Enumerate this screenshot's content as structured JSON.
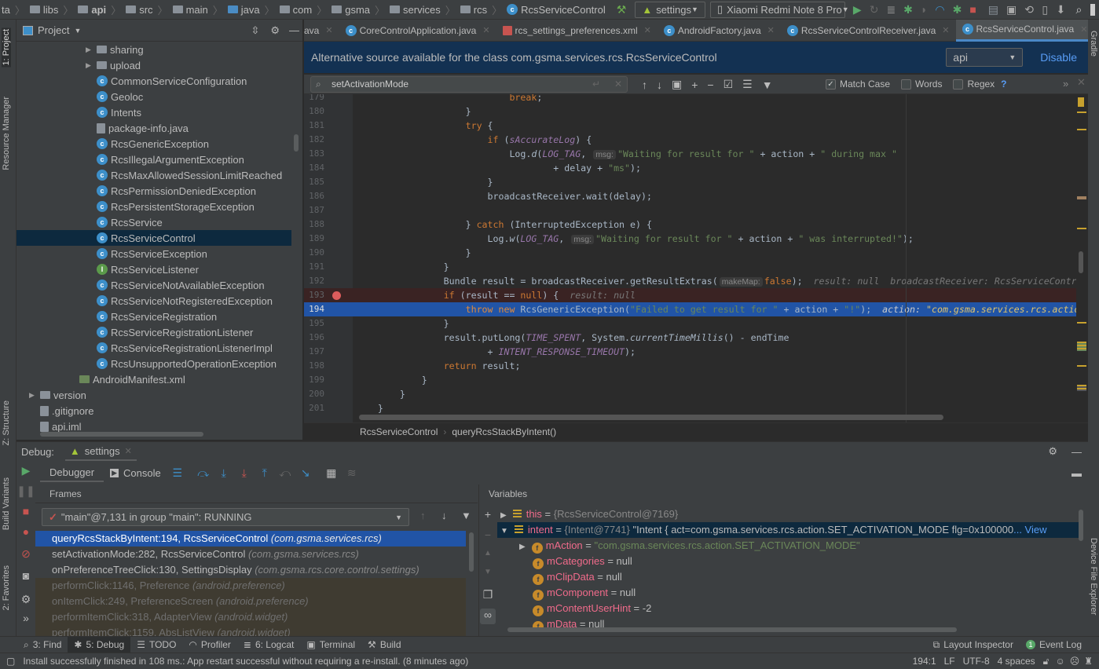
{
  "navbar": {
    "crumbs": [
      {
        "label": "ta",
        "icon": "none"
      },
      {
        "label": "libs",
        "icon": "folder"
      },
      {
        "label": "api",
        "icon": "module-folder"
      },
      {
        "label": "src",
        "icon": "folder"
      },
      {
        "label": "main",
        "icon": "folder"
      },
      {
        "label": "java",
        "icon": "source-folder"
      },
      {
        "label": "com",
        "icon": "package"
      },
      {
        "label": "gsma",
        "icon": "package"
      },
      {
        "label": "services",
        "icon": "package"
      },
      {
        "label": "rcs",
        "icon": "package"
      },
      {
        "label": "RcsServiceControl",
        "icon": "class"
      }
    ],
    "run_config": "settings",
    "device": "Xiaomi Redmi Note 8 Pro"
  },
  "left_stripe": {
    "project": "1: Project",
    "resource_manager": "Resource Manager",
    "structure": "Z: Structure",
    "build_variants": "Build Variants",
    "favorites": "2: Favorites"
  },
  "right_stripe": {
    "gradle": "Gradle",
    "device_explorer": "Device File Explorer"
  },
  "project": {
    "title": "Project",
    "items": [
      {
        "label": "sharing",
        "type": "folder",
        "expandable": true
      },
      {
        "label": "upload",
        "type": "folder",
        "expandable": true
      },
      {
        "label": "CommonServiceConfiguration",
        "type": "class"
      },
      {
        "label": "Geoloc",
        "type": "class"
      },
      {
        "label": "Intents",
        "type": "class"
      },
      {
        "label": "package-info.java",
        "type": "file"
      },
      {
        "label": "RcsGenericException",
        "type": "class"
      },
      {
        "label": "RcsIllegalArgumentException",
        "type": "class"
      },
      {
        "label": "RcsMaxAllowedSessionLimitReached",
        "type": "class"
      },
      {
        "label": "RcsPermissionDeniedException",
        "type": "class"
      },
      {
        "label": "RcsPersistentStorageException",
        "type": "class"
      },
      {
        "label": "RcsService",
        "type": "class"
      },
      {
        "label": "RcsServiceControl",
        "type": "class",
        "selected": true
      },
      {
        "label": "RcsServiceException",
        "type": "class"
      },
      {
        "label": "RcsServiceListener",
        "type": "interface"
      },
      {
        "label": "RcsServiceNotAvailableException",
        "type": "class"
      },
      {
        "label": "RcsServiceNotRegisteredException",
        "type": "class"
      },
      {
        "label": "RcsServiceRegistration",
        "type": "class"
      },
      {
        "label": "RcsServiceRegistrationListener",
        "type": "class"
      },
      {
        "label": "RcsServiceRegistrationListenerImpl",
        "type": "class"
      },
      {
        "label": "RcsUnsupportedOperationException",
        "type": "class"
      },
      {
        "label": "AndroidManifest.xml",
        "type": "manifest",
        "level": "up"
      },
      {
        "label": "version",
        "type": "folder",
        "expandable": true,
        "level": "top"
      },
      {
        "label": ".gitignore",
        "type": "file",
        "level": "top"
      },
      {
        "label": "api.iml",
        "type": "file",
        "level": "top"
      }
    ]
  },
  "tabs": [
    {
      "label": "ava"
    },
    {
      "label": "CoreControlApplication.java"
    },
    {
      "label": "rcs_settings_preferences.xml"
    },
    {
      "label": "AndroidFactory.java"
    },
    {
      "label": "RcsServiceControlReceiver.java"
    },
    {
      "label": "RcsServiceControl.java",
      "active": true
    }
  ],
  "tabs_overflow": "5",
  "banner": {
    "text": "Alternative source available for the class com.gsma.services.rcs.RcsServiceControl",
    "module": "api",
    "disable": "Disable"
  },
  "search": {
    "query": "setActivationMode",
    "match_case": "Match Case",
    "match_case_checked": true,
    "words": "Words",
    "words_checked": false,
    "regex": "Regex",
    "help": "?"
  },
  "code": [
    {
      "n": "179",
      "tokens": [
        {
          "t": "                            "
        },
        {
          "t": "break",
          "c": "kw"
        },
        {
          "t": ";"
        }
      ]
    },
    {
      "n": "180",
      "tokens": [
        {
          "t": "                    }"
        }
      ]
    },
    {
      "n": "181",
      "tokens": [
        {
          "t": "                    "
        },
        {
          "t": "try",
          "c": "kw"
        },
        {
          "t": " {"
        }
      ]
    },
    {
      "n": "182",
      "tokens": [
        {
          "t": "                        "
        },
        {
          "t": "if",
          "c": "kw"
        },
        {
          "t": " ("
        },
        {
          "t": "sAccurateLog",
          "c": "const"
        },
        {
          "t": ") {"
        }
      ]
    },
    {
      "n": "183",
      "tokens": [
        {
          "t": "                            Log."
        },
        {
          "t": "d",
          "c": "it"
        },
        {
          "t": "("
        },
        {
          "t": "LOG_TAG",
          "c": "const"
        },
        {
          "t": ", "
        },
        {
          "t": "msg:",
          "c": "hint"
        },
        {
          "t": "\"Waiting for result for \"",
          "c": "str"
        },
        {
          "t": " + action + "
        },
        {
          "t": "\" during max \"",
          "c": "str"
        }
      ]
    },
    {
      "n": "184",
      "tokens": [
        {
          "t": "                                    + delay + "
        },
        {
          "t": "\"ms\"",
          "c": "str"
        },
        {
          "t": ");"
        }
      ]
    },
    {
      "n": "185",
      "tokens": [
        {
          "t": "                        }"
        }
      ]
    },
    {
      "n": "186",
      "tokens": [
        {
          "t": "                        broadcastReceiver.wait(delay);"
        }
      ]
    },
    {
      "n": "187",
      "tokens": [
        {
          "t": ""
        }
      ]
    },
    {
      "n": "188",
      "tokens": [
        {
          "t": "                    } "
        },
        {
          "t": "catch",
          "c": "kw"
        },
        {
          "t": " (InterruptedException e) {"
        }
      ]
    },
    {
      "n": "189",
      "tokens": [
        {
          "t": "                        Log."
        },
        {
          "t": "w",
          "c": "it"
        },
        {
          "t": "("
        },
        {
          "t": "LOG_TAG",
          "c": "const"
        },
        {
          "t": ", "
        },
        {
          "t": "msg:",
          "c": "hint"
        },
        {
          "t": "\"Waiting for result for \"",
          "c": "str"
        },
        {
          "t": " + action + "
        },
        {
          "t": "\" was interrupted!\"",
          "c": "str"
        },
        {
          "t": ");"
        }
      ]
    },
    {
      "n": "190",
      "tokens": [
        {
          "t": "                    }"
        }
      ]
    },
    {
      "n": "191",
      "tokens": [
        {
          "t": "                }"
        }
      ]
    },
    {
      "n": "192",
      "tokens": [
        {
          "t": "                Bundle result = broadcastReceiver.getResultExtras("
        },
        {
          "t": "makeMap:",
          "c": "hint"
        },
        {
          "t": "false",
          "c": "kw"
        },
        {
          "t": ");"
        },
        {
          "t": "  result: null  broadcastReceiver: RcsServiceContro",
          "c": "val"
        }
      ]
    },
    {
      "n": "193",
      "breakpoint": true,
      "tokens": [
        {
          "t": "                "
        },
        {
          "t": "if",
          "c": "kw"
        },
        {
          "t": " (result == "
        },
        {
          "t": "null",
          "c": "kw"
        },
        {
          "t": ") {"
        },
        {
          "t": "  result: null",
          "c": "val"
        }
      ]
    },
    {
      "n": "194",
      "current": true,
      "tokens": [
        {
          "t": "                    "
        },
        {
          "t": "throw new",
          "c": "kw"
        },
        {
          "t": " RcsGenericException("
        },
        {
          "t": "\"Failed to get result for \"",
          "c": "str"
        },
        {
          "t": " + action + "
        },
        {
          "t": "\"!\"",
          "c": "str"
        },
        {
          "t": ");"
        },
        {
          "t": "  action: ",
          "c": "valo"
        },
        {
          "t": "\"com.gsma.services.rcs.action",
          "c": "valo2"
        }
      ]
    },
    {
      "n": "195",
      "tokens": [
        {
          "t": "                }"
        }
      ]
    },
    {
      "n": "196",
      "tokens": [
        {
          "t": "                result.putLong("
        },
        {
          "t": "TIME_SPENT",
          "c": "const"
        },
        {
          "t": ", System."
        },
        {
          "t": "currentTimeMillis",
          "c": "it"
        },
        {
          "t": "() - endTime"
        }
      ]
    },
    {
      "n": "197",
      "tokens": [
        {
          "t": "                        + "
        },
        {
          "t": "INTENT_RESPONSE_TIMEOUT",
          "c": "const"
        },
        {
          "t": ");"
        }
      ]
    },
    {
      "n": "198",
      "tokens": [
        {
          "t": "                "
        },
        {
          "t": "return",
          "c": "kw"
        },
        {
          "t": " result;"
        }
      ]
    },
    {
      "n": "199",
      "tokens": [
        {
          "t": "            }"
        }
      ]
    },
    {
      "n": "200",
      "tokens": [
        {
          "t": "        }"
        }
      ]
    },
    {
      "n": "201",
      "tokens": [
        {
          "t": "    }"
        }
      ]
    }
  ],
  "breadcrumb": {
    "class": "RcsServiceControl",
    "method": "queryRcsStackByIntent()"
  },
  "debug": {
    "title": "Debug:",
    "session": "settings",
    "tabs": {
      "debugger": "Debugger",
      "console": "Console"
    },
    "frames_title": "Frames",
    "thread": "\"main\"@7,131 in group \"main\": RUNNING",
    "frames": [
      {
        "method": "queryRcsStackByIntent:194, RcsServiceControl",
        "pkg": "(com.gsma.services.rcs)",
        "state": "selected"
      },
      {
        "method": "setActivationMode:282, RcsServiceControl",
        "pkg": "(com.gsma.services.rcs)",
        "state": "user"
      },
      {
        "method": "onPreferenceTreeClick:130, SettingsDisplay",
        "pkg": "(com.gsma.rcs.core.control.settings)",
        "state": "user"
      },
      {
        "method": "performClick:1146, Preference",
        "pkg": "(android.preference)",
        "state": "library"
      },
      {
        "method": "onItemClick:249, PreferenceScreen",
        "pkg": "(android.preference)",
        "state": "library"
      },
      {
        "method": "performItemClick:318, AdapterView",
        "pkg": "(android.widget)",
        "state": "library"
      },
      {
        "method": "performItemClick:1159, AbsListView",
        "pkg": "(android.widget)",
        "state": "library"
      }
    ],
    "variables_title": "Variables",
    "variables": [
      {
        "name": "this",
        "eq": " = ",
        "ref": "{RcsServiceControl@7169}",
        "value": "",
        "kind": "local",
        "expand": "collapsed"
      },
      {
        "name": "intent",
        "eq": " = ",
        "ref": "{Intent@7741}",
        "value": " \"Intent { act=com.gsma.services.rcs.action.SET_ACTIVATION_MODE flg=0x100000",
        "more": "... View",
        "kind": "local",
        "expand": "expanded"
      },
      {
        "name": "mAction",
        "eq": " = ",
        "ref": "",
        "value": "\"com.gsma.services.rcs.action.SET_ACTIVATION_MODE\"",
        "kind": "field",
        "expand": "collapsed",
        "string": true
      },
      {
        "name": "mCategories",
        "eq": " = ",
        "ref": "",
        "value": "null",
        "kind": "field"
      },
      {
        "name": "mClipData",
        "eq": " = ",
        "ref": "",
        "value": "null",
        "kind": "field"
      },
      {
        "name": "mComponent",
        "eq": " = ",
        "ref": "",
        "value": "null",
        "kind": "field"
      },
      {
        "name": "mContentUserHint",
        "eq": " = ",
        "ref": "",
        "value": "-2",
        "kind": "field"
      },
      {
        "name": "mData",
        "eq": " = ",
        "ref": "",
        "value": "null",
        "kind": "field"
      }
    ]
  },
  "tool_windows": [
    {
      "label": "3: Find",
      "icon": "search-icon"
    },
    {
      "label": "5: Debug",
      "icon": "bug-icon",
      "active": true
    },
    {
      "label": "TODO",
      "icon": "list-icon"
    },
    {
      "label": "Profiler",
      "icon": "gauge-icon"
    },
    {
      "label": "6: Logcat",
      "icon": "logcat-icon"
    },
    {
      "label": "Terminal",
      "icon": "terminal-icon"
    },
    {
      "label": "Build",
      "icon": "hammer-icon"
    }
  ],
  "right_tools": {
    "layout_inspector": "Layout Inspector",
    "event_log": "Event Log",
    "event_count": "1"
  },
  "status": {
    "message": "Install successfully finished in 108 ms.: App restart successful without requiring a re-install. (8 minutes ago)",
    "position": "194:1",
    "line_sep": "LF",
    "encoding": "UTF-8",
    "indent": "4 spaces"
  }
}
